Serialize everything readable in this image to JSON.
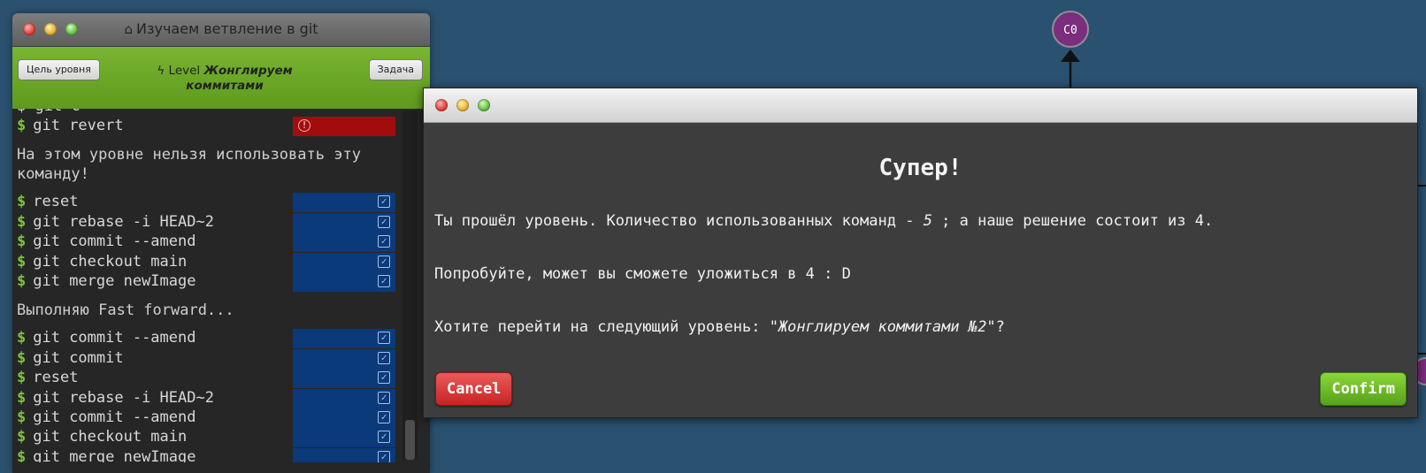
{
  "terminal": {
    "title": "Изучаем ветвление в git",
    "goal_button": "Цель уровня",
    "level_prefix": "Level",
    "level_name_line1": "Жонглируем",
    "level_name_line2": "коммитами",
    "task_button": "Задача",
    "partial_top_line": "$ git c",
    "lines": [
      {
        "kind": "cmd",
        "text": "git revert",
        "status": "error"
      },
      {
        "kind": "msg",
        "text": "На этом уровне нельзя использовать эту команду!"
      },
      {
        "kind": "cmd",
        "text": "reset",
        "status": "ok"
      },
      {
        "kind": "cmd",
        "text": "git rebase -i HEAD~2",
        "status": "ok"
      },
      {
        "kind": "cmd",
        "text": "git commit --amend",
        "status": "ok"
      },
      {
        "kind": "cmd",
        "text": "git checkout main",
        "status": "ok"
      },
      {
        "kind": "cmd",
        "text": "git merge newImage",
        "status": "ok"
      },
      {
        "kind": "msg",
        "text": "Выполняю Fast forward..."
      },
      {
        "kind": "cmd",
        "text": "git commit --amend",
        "status": "ok"
      },
      {
        "kind": "cmd",
        "text": "git commit",
        "status": "ok"
      },
      {
        "kind": "cmd",
        "text": "reset",
        "status": "ok"
      },
      {
        "kind": "cmd",
        "text": "git rebase -i HEAD~2",
        "status": "ok"
      },
      {
        "kind": "cmd",
        "text": "git commit --amend",
        "status": "ok"
      },
      {
        "kind": "cmd",
        "text": "git checkout main",
        "status": "ok"
      },
      {
        "kind": "cmd",
        "text": "git merge newImage",
        "status": "ok"
      }
    ]
  },
  "graph": {
    "commit_label": "C0",
    "commit_color": "#7b2d7e"
  },
  "modal": {
    "heading": "Супер!",
    "line1_a": "Ты прошёл уровень. Количество использованных команд - ",
    "line1_count": "5",
    "line1_b": " ; а наше решение состоит из 4.",
    "line2": "Попробуйте, может вы сможете уложиться в 4 : D",
    "line3_a": "Хотите перейти на следующий уровень: ",
    "line3_level": "\"Жонглируем коммитами №2\"",
    "line3_b": "?",
    "cancel_label": "Cancel",
    "confirm_label": "Confirm"
  },
  "colors": {
    "background": "#2a5170",
    "prompt": "#7bc43d",
    "status_ok": "#0a3a79",
    "status_error": "#a30c0c"
  }
}
